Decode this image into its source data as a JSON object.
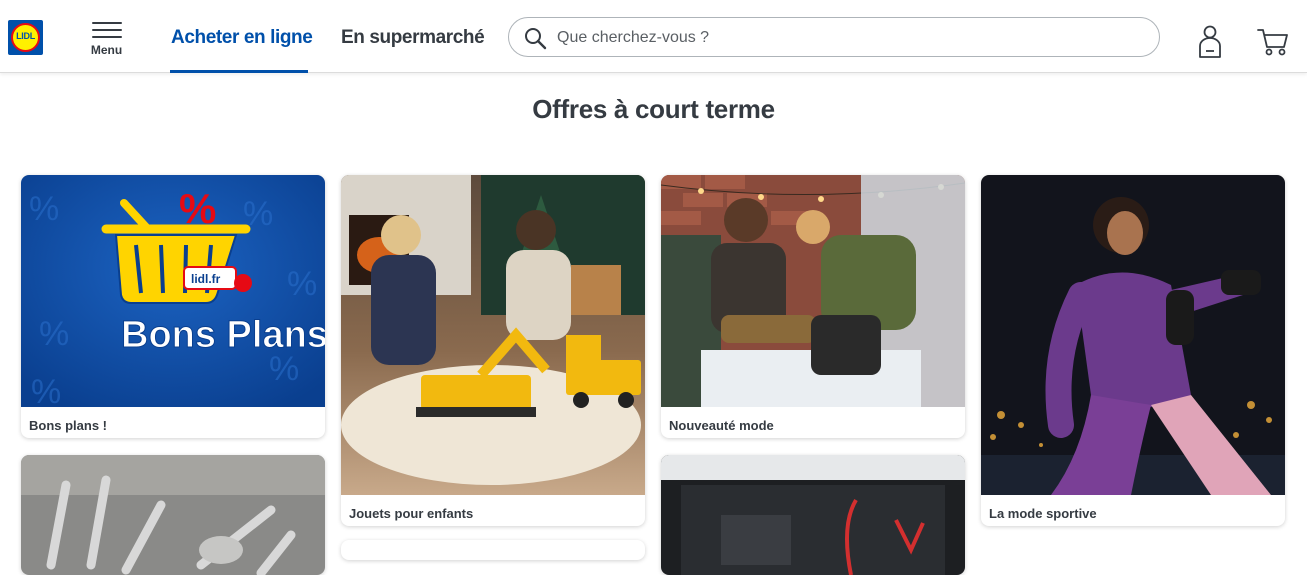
{
  "header": {
    "logo_text": "LIDL",
    "menu_label": "Menu",
    "tabs": [
      {
        "label": "Acheter en ligne",
        "active": true
      },
      {
        "label": "En supermarché",
        "active": false
      }
    ],
    "search": {
      "placeholder": "Que cherchez-vous ?"
    },
    "icons": [
      "search-icon",
      "account-icon",
      "cart-icon",
      "hamburger-icon"
    ],
    "accent_color": "#0050aa"
  },
  "main": {
    "title": "Offres à court terme",
    "cards": [
      {
        "label": "Bons plans !",
        "image": "bons-plans-basket",
        "overlay": "lidl.fr",
        "image_title": "Bons Plans"
      },
      {
        "label": "Jouets pour enfants",
        "image": "kids-toy-trucks"
      },
      {
        "label": "Nouveauté mode",
        "image": "couple-winter-fashion"
      },
      {
        "label": "La mode sportive",
        "image": "woman-sportswear-night"
      },
      {
        "label": "",
        "image": "drill-bits"
      },
      {
        "label": "",
        "image": "car-jumper-cables"
      }
    ]
  }
}
